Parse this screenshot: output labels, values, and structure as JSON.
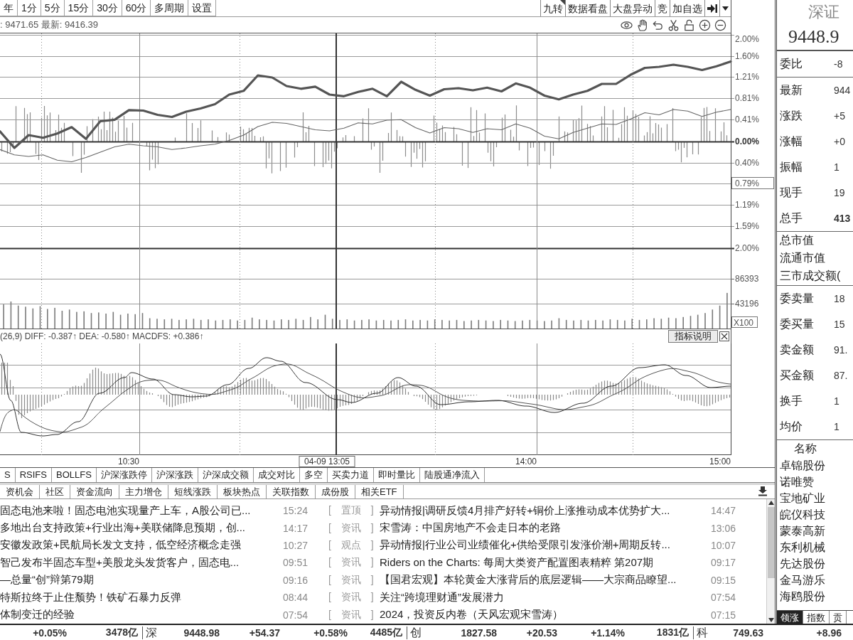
{
  "toolbar": {
    "period_tabs": [
      {
        "label": "年",
        "selected": false
      },
      {
        "label": "1分",
        "selected": false
      },
      {
        "label": "5分",
        "selected": false
      },
      {
        "label": "15分",
        "selected": false
      },
      {
        "label": "30分",
        "selected": false
      },
      {
        "label": "60分",
        "selected": false
      },
      {
        "label": "多周期",
        "selected": false
      },
      {
        "label": "设置",
        "selected": false
      }
    ],
    "tools": [
      {
        "kind": "text",
        "label": "九转",
        "corner_mark": true
      },
      {
        "kind": "text",
        "label": "数据看盘",
        "corner_mark": false
      },
      {
        "kind": "text",
        "label": "大盘异动",
        "corner_mark": false
      },
      {
        "kind": "text",
        "label": "竞",
        "corner_mark": false
      },
      {
        "kind": "text",
        "label": "加自选",
        "corner_mark": false
      },
      {
        "kind": "icon"
      },
      {
        "kind": "dropdown"
      }
    ]
  },
  "info_bar": {
    "text": ": 9471.65 最新: 9416.39"
  },
  "main_chart": {
    "chart_data": {
      "type": "line",
      "ylim": [
        -2,
        2
      ],
      "yticks": [
        {
          "value": 2,
          "label": "2.00%"
        },
        {
          "value": 1.6,
          "label": "1.60%"
        },
        {
          "value": 1.21,
          "label": "1.21%"
        },
        {
          "value": 0.81,
          "label": "0.81%"
        },
        {
          "value": 0.41,
          "label": "0.41%"
        },
        {
          "value": 0,
          "label": "0.00%"
        },
        {
          "value": -0.4,
          "label": "0.40%"
        },
        {
          "value": -0.79,
          "label": "0.79%"
        },
        {
          "value": -1.19,
          "label": "1.19%"
        },
        {
          "value": -1.59,
          "label": "1.59%"
        },
        {
          "value": -2,
          "label": "2.00%"
        }
      ],
      "grid": true,
      "series": [
        {
          "color": "#555555",
          "values": [
            0.19,
            -0.12,
            0.12,
            0.07,
            0.15,
            0.27,
            0.05,
            0.38,
            0.41,
            0.59,
            0.58,
            0.5,
            0.46,
            0.56,
            0.62,
            0.7,
            0.88,
            0.95,
            1.24,
            1.2,
            1.04,
            0.99,
            1.03,
            0.88,
            0.85,
            0.93,
            0.99,
            0.85,
            1.12,
            0.97,
            0.86,
            0.98,
            1.0,
            0.96,
            1.01,
            0.94,
            1.09,
            1.01,
            0.86,
            0.79,
            0.88,
            0.95,
            1.08,
            1.08,
            1.25,
            1.38,
            1.4,
            1.44,
            1.4,
            1.34,
            1.41,
            1.5
          ]
        },
        {
          "color": "#666666",
          "values": [
            -0.15,
            -0.25,
            -0.28,
            -0.25,
            -0.35,
            -0.38,
            -0.3,
            -0.2,
            -0.1,
            -0.05,
            -0.08,
            -0.1,
            -0.15,
            -0.12,
            -0.08,
            -0.05,
            0.02,
            0.12,
            0.28,
            0.36,
            0.34,
            0.28,
            0.22,
            0.2,
            0.25,
            0.35,
            0.33,
            0.4,
            0.41,
            0.26,
            0.16,
            0.26,
            0.24,
            0.17,
            0.24,
            0.22,
            0.33,
            0.25,
            0.1,
            0.05,
            0.17,
            0.25,
            0.33,
            0.32,
            0.42,
            0.54,
            0.5,
            0.6,
            0.57,
            0.47,
            0.55,
            0.6
          ]
        }
      ]
    }
  },
  "volume_chart": {
    "unit": "X100",
    "chart_data": {
      "type": "bar",
      "categories": [
        null,
        null,
        null,
        null,
        null,
        null,
        null,
        null,
        null,
        null,
        null,
        null,
        null,
        null,
        null,
        null,
        null,
        null,
        null,
        null,
        null,
        null,
        null,
        null,
        null,
        null,
        null,
        null,
        null,
        null,
        null,
        null,
        null,
        null,
        null,
        null,
        null,
        null,
        null,
        null,
        null,
        null,
        null,
        null,
        null,
        null,
        null,
        null,
        null,
        null,
        null,
        null,
        null,
        null,
        null,
        null,
        null,
        null,
        null,
        null,
        null,
        null,
        null,
        null,
        null,
        null,
        null,
        null,
        null,
        null,
        null,
        null,
        null,
        null,
        null,
        null,
        null,
        null,
        null,
        null,
        null,
        null,
        null,
        null,
        null,
        null,
        null,
        null,
        null,
        null,
        null,
        null,
        null,
        null,
        null,
        null,
        null,
        null,
        null,
        null
      ],
      "ylim": [
        0,
        130000
      ],
      "yticks": [
        {
          "value": 86393,
          "label": "86393"
        },
        {
          "value": 43196,
          "label": "43196"
        }
      ],
      "grid": true,
      "values": [
        42000,
        47000,
        40000,
        38000,
        35000,
        39000,
        34000,
        36000,
        31000,
        33000,
        29000,
        30000,
        27000,
        28000,
        26000,
        29000,
        24000,
        26000,
        25000,
        27000,
        18000,
        17000,
        16000,
        17000,
        15000,
        16000,
        17000,
        15000,
        16000,
        14000,
        15000,
        16000,
        14000,
        15000,
        19000,
        16000,
        15000,
        14000,
        16000,
        15000,
        17000,
        15000,
        20000,
        16000,
        24000,
        17000,
        15000,
        16000,
        14000,
        15000,
        16000,
        14000,
        15000,
        14000,
        15000,
        16000,
        14000,
        15000,
        14000,
        16000,
        15000,
        14000,
        15000,
        13000,
        14000,
        15000,
        14000,
        13000,
        15000,
        14000,
        13000,
        14000,
        15000,
        14000,
        13000,
        14000,
        18000,
        15000,
        14000,
        15000,
        14000,
        15000,
        14000,
        16000,
        15000,
        14000,
        17000,
        15000,
        16000,
        18000,
        17000,
        19000,
        18000,
        20000,
        22000,
        24000,
        27000,
        33000,
        40000,
        62000
      ]
    }
  },
  "macd": {
    "legend": "(26,9) DIFF: -0.387↑ DEA: -0.580↑ MACDFS: +0.386↑",
    "help_button": "指标说明"
  },
  "time_axis": {
    "ticks": [
      "10:30",
      "14:00",
      "15:00"
    ],
    "crosshair_label": "04-09 13:05"
  },
  "indicator_tabs": [
    {
      "label": "S",
      "selected": false
    },
    {
      "label": "RSIFS",
      "selected": false
    },
    {
      "label": "BOLLFS",
      "selected": false
    },
    {
      "label": "沪深涨跌停",
      "selected": false
    },
    {
      "label": "沪深涨跌",
      "selected": false
    },
    {
      "label": "沪深成交额",
      "selected": false
    },
    {
      "label": "成交对比",
      "selected": false
    },
    {
      "label": "多空",
      "selected": false
    },
    {
      "label": "买卖力道",
      "selected": false
    },
    {
      "label": "即时量比",
      "selected": false
    },
    {
      "label": "陆股通净流入",
      "selected": false
    }
  ],
  "news_tabs": [
    {
      "label": "资机会",
      "selected": false
    },
    {
      "label": "社区",
      "selected": false
    },
    {
      "label": "资金流向",
      "selected": false
    },
    {
      "label": "主力增仓",
      "selected": false
    },
    {
      "label": "短线涨跌",
      "selected": false
    },
    {
      "label": "板块热点",
      "selected": false
    },
    {
      "label": "关联指数",
      "selected": false
    },
    {
      "label": "成份股",
      "selected": false
    },
    {
      "label": "相关ETF",
      "selected": false
    }
  ],
  "news": {
    "left": [
      {
        "title": "固态电池来啦！固态电池实现量产上车，A股公司已...",
        "time": "15:24"
      },
      {
        "title": "多地出台支持政策+行业出海+美联储降息预期，创...",
        "time": "14:17"
      },
      {
        "title": "安徽发政策+民航局长发文支持，低空经济概念走强",
        "time": "10:27"
      },
      {
        "title": "智己发布半固态车型+美股龙头发货客户，固态电...",
        "time": "09:51"
      },
      {
        "title": "—总量“创”辩第79期",
        "time": "09:16"
      },
      {
        "title": "特斯拉终于止住颓势！铁矿石暴力反弹",
        "time": "08:44"
      },
      {
        "title": "体制变迁的经验",
        "time": "07:54"
      }
    ],
    "right": [
      {
        "tag": "[ 置顶 ]",
        "title": "异动情报|调研反馈4月排产好转+铜价上涨推动成本优势扩大...",
        "time": "14:47"
      },
      {
        "tag": "[ 资讯 ]",
        "title": "宋雪涛：中国房地产不会走日本的老路",
        "time": "13:06"
      },
      {
        "tag": "[ 观点 ]",
        "title": "异动情报|行业公司业绩催化+供给受限引发涨价潮+周期反转...",
        "time": "10:07"
      },
      {
        "tag": "[ 资讯 ]",
        "title": "Riders on the Charts: 每周大类资产配置图表精粹 第207期",
        "time": "09:17"
      },
      {
        "tag": "[ 资讯 ]",
        "title": "【国君宏观】本轮黄金大涨背后的底层逻辑——大宗商品瞭望...",
        "time": "09:15"
      },
      {
        "tag": "[ 资讯 ]",
        "title": "关注“跨境理财通”发展潜力",
        "time": "07:54"
      },
      {
        "tag": "[ 资讯 ]",
        "title": "2024，投资反内卷（天风宏观宋雪涛）",
        "time": "07:15"
      }
    ]
  },
  "status_bar": [
    {
      "kind": "value",
      "text": "+0.05%"
    },
    {
      "kind": "value",
      "text": "3478亿"
    },
    {
      "kind": "market",
      "text": "深"
    },
    {
      "kind": "value",
      "text": "9448.98"
    },
    {
      "kind": "value",
      "text": "+54.37"
    },
    {
      "kind": "value",
      "text": "+0.58%"
    },
    {
      "kind": "value",
      "text": "4485亿"
    },
    {
      "kind": "market",
      "text": "创"
    },
    {
      "kind": "value",
      "text": "1827.58"
    },
    {
      "kind": "value",
      "text": "+20.53"
    },
    {
      "kind": "value",
      "text": "+1.14%"
    },
    {
      "kind": "value",
      "text": "1831亿"
    },
    {
      "kind": "market",
      "text": "科"
    },
    {
      "kind": "value",
      "text": "749.63"
    },
    {
      "kind": "value",
      "text": "+8.96"
    }
  ],
  "quote_panel": {
    "title": "深证",
    "price": "9448.9",
    "sections": [
      {
        "kind": "stat",
        "rows": [
          {
            "label": "委比",
            "value": "-8",
            "emphasized": false
          }
        ]
      },
      {
        "kind": "stat",
        "rows": [
          {
            "label": "最新",
            "value": "944",
            "emphasized": false
          },
          {
            "label": "涨跌",
            "value": "+5",
            "emphasized": false
          },
          {
            "label": "涨幅",
            "value": "+0",
            "emphasized": false
          },
          {
            "label": "振幅",
            "value": "1",
            "emphasized": false
          },
          {
            "label": "现手",
            "value": "19",
            "emphasized": false
          },
          {
            "label": "总手",
            "value": "413",
            "emphasized": true
          }
        ]
      },
      {
        "kind": "note",
        "rows": [
          {
            "label": "总市值"
          },
          {
            "label": "流通市值"
          },
          {
            "label": "三市成交额("
          }
        ]
      },
      {
        "kind": "stat",
        "rows": [
          {
            "label": "委卖量",
            "value": "18",
            "emphasized": false
          },
          {
            "label": "委买量",
            "value": "15",
            "emphasized": false
          },
          {
            "label": "卖金额",
            "value": "91.",
            "emphasized": false
          },
          {
            "label": "买金额",
            "value": "87.",
            "emphasized": false
          },
          {
            "label": "换手",
            "value": "1",
            "emphasized": false
          },
          {
            "label": "均价",
            "value": "1",
            "emphasized": false
          }
        ]
      }
    ],
    "list": {
      "header": "名称",
      "items": [
        "卓锦股份",
        "诺唯赞",
        "宝地矿业",
        "皖仪科技",
        "蒙泰高新",
        "东利机械",
        "先达股份",
        "金马游乐",
        "海鸥股份"
      ]
    },
    "tabs": [
      {
        "label": "领涨",
        "selected": true
      },
      {
        "label": "指数",
        "selected": false
      },
      {
        "label": "贡",
        "selected": false
      }
    ]
  }
}
